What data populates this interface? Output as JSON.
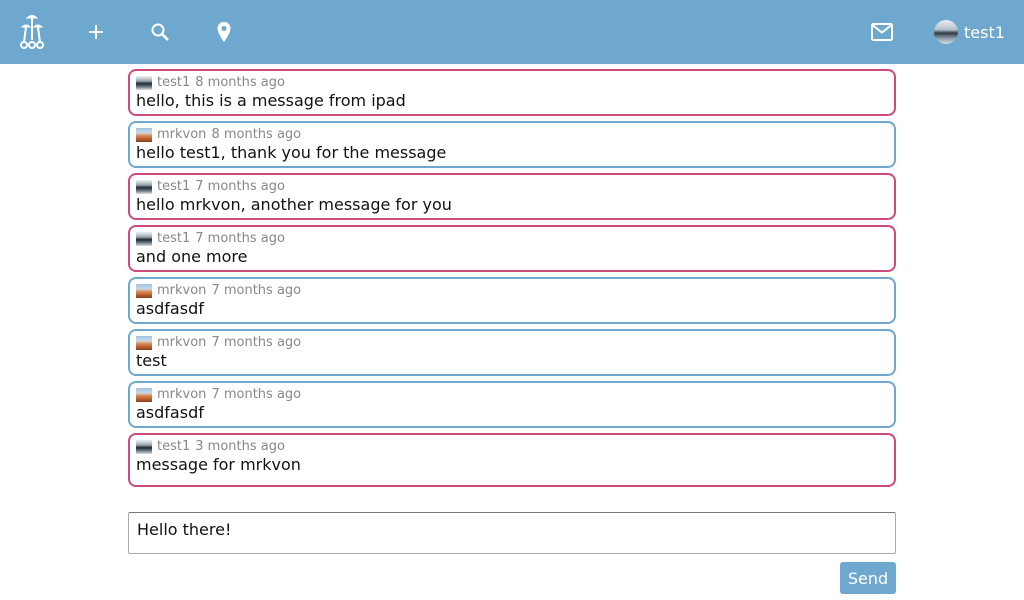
{
  "header": {
    "logo_icon": "mushroom-logo-icon",
    "add_icon": "plus-icon",
    "search_icon": "search-icon",
    "location_icon": "map-pin-icon",
    "mail_icon": "mail-icon",
    "user": {
      "name": "test1",
      "avatar_icon": "user-avatar-icon"
    }
  },
  "messages": [
    {
      "author": "test1",
      "time": "8 months ago",
      "text": "hello, this is a message from ipad",
      "mine": true
    },
    {
      "author": "mrkvon",
      "time": "8 months ago",
      "text": "hello test1, thank you for the message",
      "mine": false
    },
    {
      "author": "test1",
      "time": "7 months ago",
      "text": "hello mrkvon, another message for you",
      "mine": true
    },
    {
      "author": "test1",
      "time": "7 months ago",
      "text": "and one more",
      "mine": true
    },
    {
      "author": "mrkvon",
      "time": "7 months ago",
      "text": "asdfasdf",
      "mine": false
    },
    {
      "author": "mrkvon",
      "time": "7 months ago",
      "text": "test",
      "mine": false
    },
    {
      "author": "mrkvon",
      "time": "7 months ago",
      "text": "asdfasdf",
      "mine": false
    },
    {
      "author": "test1",
      "time": "3 months ago",
      "text": "message for mrkvon",
      "mine": true
    }
  ],
  "composer": {
    "value": "Hello there!"
  },
  "send": {
    "label": "Send"
  },
  "colors": {
    "header": "#6fa8cf",
    "mine_border": "#cc4a7d",
    "theirs_border": "#6fa8cf",
    "send_button": "#6fa8cf"
  }
}
